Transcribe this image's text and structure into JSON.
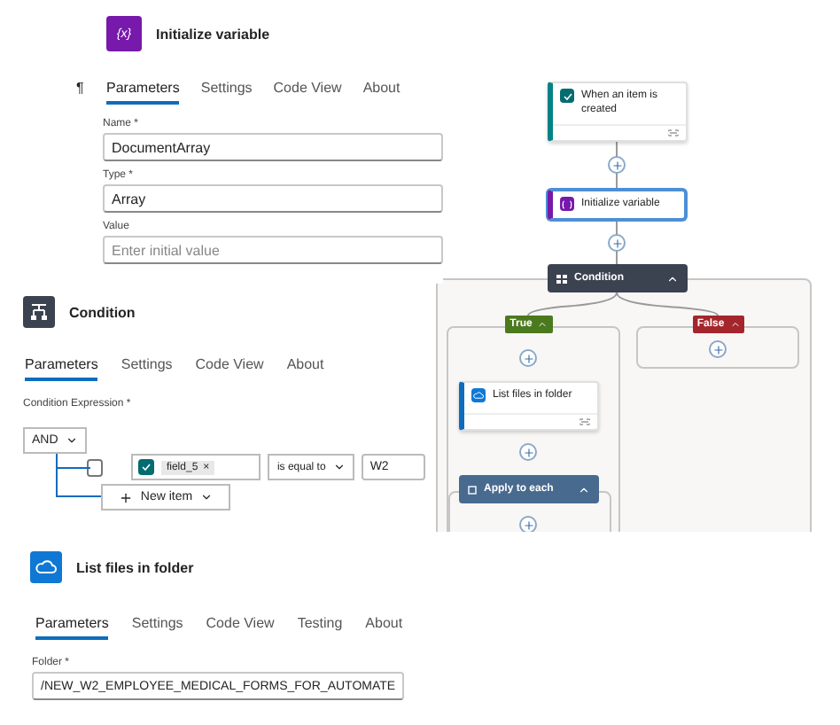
{
  "initialize_variable_panel": {
    "icon_text": "{x}",
    "title": "Initialize variable",
    "pilcrow": "¶",
    "tabs": [
      {
        "label": "Parameters",
        "selected": true
      },
      {
        "label": "Settings",
        "selected": false
      },
      {
        "label": "Code View",
        "selected": false
      },
      {
        "label": "About",
        "selected": false
      }
    ],
    "fields": [
      {
        "label": "Name *",
        "value": "DocumentArray"
      },
      {
        "label": "Type *",
        "value": "Array"
      },
      {
        "label": "Value",
        "placeholder": "Enter initial value"
      }
    ]
  },
  "flow": {
    "trigger": {
      "title": "When an item is created"
    },
    "init_card": {
      "title": "Initialize variable",
      "selected": true
    },
    "condition": {
      "title": "Condition"
    },
    "branches": [
      {
        "label": "True",
        "color": "#4b7a1e"
      },
      {
        "label": "False",
        "color": "#a4262c"
      }
    ],
    "list_card": {
      "title": "List files in folder"
    },
    "loop": {
      "title": "Apply to each"
    }
  },
  "condition_panel": {
    "title": "Condition",
    "tabs": [
      {
        "label": "Parameters",
        "selected": true
      },
      {
        "label": "Settings",
        "selected": false
      },
      {
        "label": "Code View",
        "selected": false
      },
      {
        "label": "About",
        "selected": false
      }
    ],
    "expression_label": "Condition Expression *",
    "group_operator": "AND",
    "rows": [
      {
        "checked": false,
        "token": "field_5",
        "token_remove": "×",
        "operator": "is equal to",
        "value": "W2"
      }
    ],
    "add_button": "New item"
  },
  "list_files_panel": {
    "title": "List files in folder",
    "tabs": [
      {
        "label": "Parameters",
        "selected": true
      },
      {
        "label": "Settings",
        "selected": false
      },
      {
        "label": "Code View",
        "selected": false
      },
      {
        "label": "Testing",
        "selected": false
      },
      {
        "label": "About",
        "selected": false
      }
    ],
    "fields": [
      {
        "label": "Folder *",
        "value": "/NEW_W2_EMPLOYEE_MEDICAL_FORMS_FOR_AUTOMATE"
      }
    ]
  }
}
